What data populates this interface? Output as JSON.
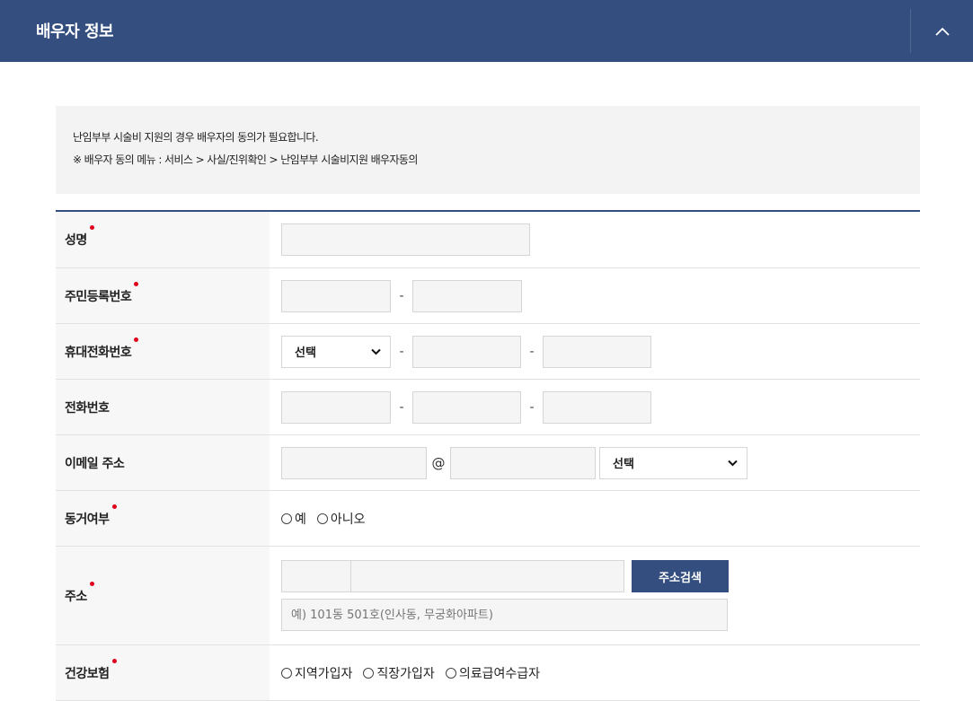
{
  "panel": {
    "title": "배우자 정보",
    "collapse_icon": "chevron-up-icon",
    "accent_color": "#334e7f",
    "required_color": "#e0001b"
  },
  "notice": {
    "line1": "난임부부 시술비 지원의 경우 배우자의 동의가 필요합니다.",
    "line2": "※ 배우자 동의 메뉴 : 서비스 > 사실/진위확인 > 난임부부 시술비지원 배우자동의"
  },
  "form": {
    "name": {
      "label": "성명",
      "required": true,
      "value": ""
    },
    "resident_number": {
      "label": "주민등록번호",
      "required": true,
      "dash": "-"
    },
    "mobile": {
      "label": "휴대전화번호",
      "required": true,
      "select_value": "선택",
      "dash": "-"
    },
    "phone": {
      "label": "전화번호",
      "required": false,
      "dash": "-"
    },
    "email": {
      "label": "이메일 주소",
      "required": false,
      "at": "@",
      "select_value": "선택"
    },
    "cohabitation": {
      "label": "동거여부",
      "required": true,
      "options": [
        "예",
        "아니오"
      ]
    },
    "address": {
      "label": "주소",
      "required": true,
      "search_button": "주소검색",
      "detail_placeholder": "예) 101동 501호(인사동, 무궁화아파트)"
    },
    "health_insurance": {
      "label": "건강보험",
      "required": true,
      "options": [
        "지역가입자",
        "직장가입자",
        "의료급여수급자"
      ]
    }
  }
}
